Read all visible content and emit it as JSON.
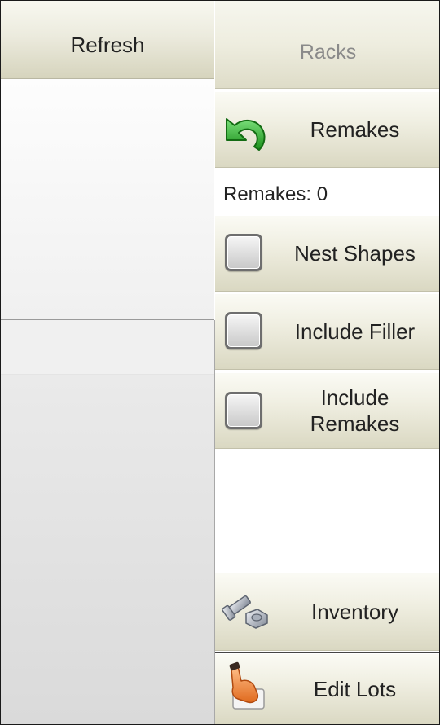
{
  "left_panel": {
    "refresh_label": "Refresh"
  },
  "right_panel": {
    "racks_header": "Racks",
    "remakes_button": {
      "label": "Remakes",
      "icon": "undo-arrow-icon"
    },
    "remakes_count": "Remakes: 0",
    "options": [
      {
        "label": "Nest Shapes",
        "checked": false
      },
      {
        "label": "Include Filler",
        "checked": false
      },
      {
        "label": "Include Remakes",
        "checked": false
      }
    ],
    "inventory_button": {
      "label": "Inventory",
      "icon": "bolt-nut-icon"
    },
    "edit_lots_button": {
      "label": "Edit Lots",
      "icon": "hand-pointer-icon"
    }
  },
  "colors": {
    "button_gradient_top": "#fbfbf5",
    "button_gradient_bottom": "#dad8c2",
    "disabled_text": "#8a8a8a",
    "undo_arrow": "#2aa52a"
  }
}
